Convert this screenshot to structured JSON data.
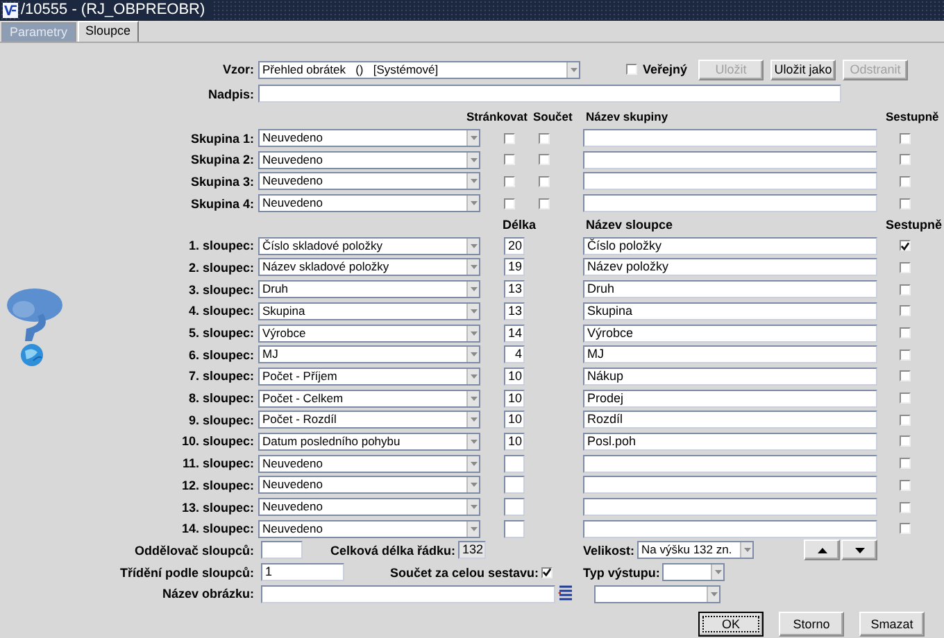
{
  "window": {
    "title": "/10555 - (RJ_OBPREOBR)"
  },
  "tabs": [
    {
      "label": "Parametry",
      "selected": false
    },
    {
      "label": "Sloupce",
      "selected": true
    }
  ],
  "template": {
    "label": "Vzor:",
    "value": "Přehled obrátek   ()   [Systémové]"
  },
  "public": {
    "label": "Veřejný",
    "checked": false
  },
  "template_buttons": [
    {
      "label": "Uložit",
      "disabled": true
    },
    {
      "label": "Uložit jako",
      "disabled": false
    },
    {
      "label": "Odstranit",
      "disabled": true
    }
  ],
  "heading": {
    "label": "Nadpis:"
  },
  "group_headers": {
    "paginate": "Stránkovat",
    "sum": "Součet",
    "name": "Název skupiny",
    "descending": "Sestupně"
  },
  "groups": [
    {
      "label": "Skupina 1:",
      "value": "Neuvedeno",
      "paginate": false,
      "sum": false,
      "descending": false
    },
    {
      "label": "Skupina 2:",
      "value": "Neuvedeno",
      "paginate": false,
      "sum": false,
      "descending": false
    },
    {
      "label": "Skupina 3:",
      "value": "Neuvedeno",
      "paginate": false,
      "sum": false,
      "descending": false
    },
    {
      "label": "Skupina 4:",
      "value": "Neuvedeno",
      "paginate": false,
      "sum": false,
      "descending": false
    }
  ],
  "column_headers": {
    "length": "Délka",
    "name": "Název sloupce",
    "descending": "Sestupně"
  },
  "columns": [
    {
      "label": "1. sloupec:",
      "value": "Číslo skladové položky",
      "length": "20",
      "name": "Číslo položky",
      "descending": true
    },
    {
      "label": "2. sloupec:",
      "value": "Název skladové položky",
      "length": "19",
      "name": "Název položky",
      "descending": false
    },
    {
      "label": "3. sloupec:",
      "value": "Druh",
      "length": "13",
      "name": "Druh",
      "descending": false
    },
    {
      "label": "4. sloupec:",
      "value": "Skupina",
      "length": "13",
      "name": "Skupina",
      "descending": false
    },
    {
      "label": "5. sloupec:",
      "value": "Výrobce",
      "length": "14",
      "name": "Výrobce",
      "descending": false
    },
    {
      "label": "6. sloupec:",
      "value": "MJ",
      "length": "4",
      "name": "MJ",
      "descending": false
    },
    {
      "label": "7. sloupec:",
      "value": "Počet - Příjem",
      "length": "10",
      "name": "Nákup",
      "descending": false
    },
    {
      "label": "8. sloupec:",
      "value": "Počet - Celkem",
      "length": "10",
      "name": "Prodej",
      "descending": false
    },
    {
      "label": "9. sloupec:",
      "value": "Počet - Rozdíl",
      "length": "10",
      "name": "Rozdíl",
      "descending": false
    },
    {
      "label": "10. sloupec:",
      "value": "Datum posledního pohybu",
      "length": "10",
      "name": "Posl.poh",
      "descending": false
    },
    {
      "label": "11. sloupec:",
      "value": "Neuvedeno",
      "descending": false
    },
    {
      "label": "12. sloupec:",
      "value": "Neuvedeno",
      "descending": false
    },
    {
      "label": "13. sloupec:",
      "value": "Neuvedeno",
      "descending": false
    },
    {
      "label": "14. sloupec:",
      "value": "Neuvedeno",
      "descending": false
    }
  ],
  "separator": {
    "label": "Oddělovač sloupců:"
  },
  "total_length": {
    "label": "Celková délka řádku:",
    "value": "132"
  },
  "size": {
    "label": "Velikost:",
    "value": "Na výšku 132 zn."
  },
  "sort": {
    "label": "Třídění podle sloupců:",
    "value": "1"
  },
  "grand_total": {
    "label": "Součet za celou sestavu:",
    "checked": true
  },
  "output_type": {
    "label": "Typ výstupu:"
  },
  "image_name": {
    "label": "Název obrázku:"
  },
  "buttons": [
    {
      "label": "OK",
      "focused": true
    },
    {
      "label": "Storno",
      "focused": false
    },
    {
      "label": "Smazat",
      "focused": false
    }
  ]
}
